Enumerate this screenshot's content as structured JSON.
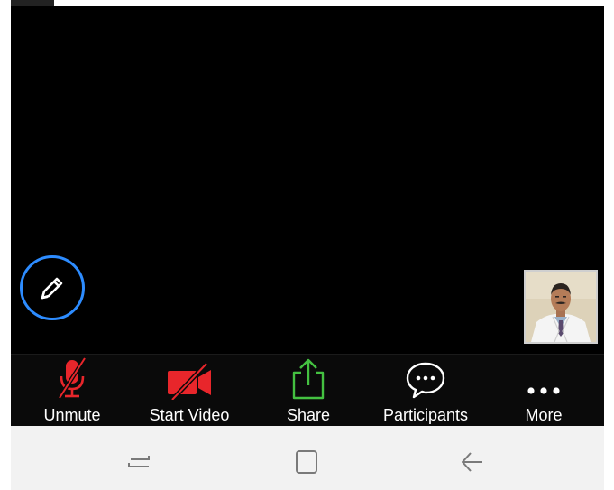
{
  "toolbar": {
    "unmute_label": "Unmute",
    "start_video_label": "Start Video",
    "share_label": "Share",
    "participants_label": "Participants",
    "more_label": "More"
  },
  "icons": {
    "annotate": "pencil-icon",
    "unmute": "muted-microphone-icon",
    "start_video": "video-off-icon",
    "share": "share-upload-icon",
    "participants": "chat-bubble-icon",
    "more": "ellipsis-icon",
    "nav_recent": "recent-apps-icon",
    "nav_home": "home-icon",
    "nav_back": "back-arrow-icon"
  },
  "colors": {
    "accent_blue": "#2d8cff",
    "muted_red": "#e8262b",
    "share_green": "#44c141",
    "toolbar_bg": "#0a0a0a",
    "navbar_bg": "#f2f2f2"
  }
}
